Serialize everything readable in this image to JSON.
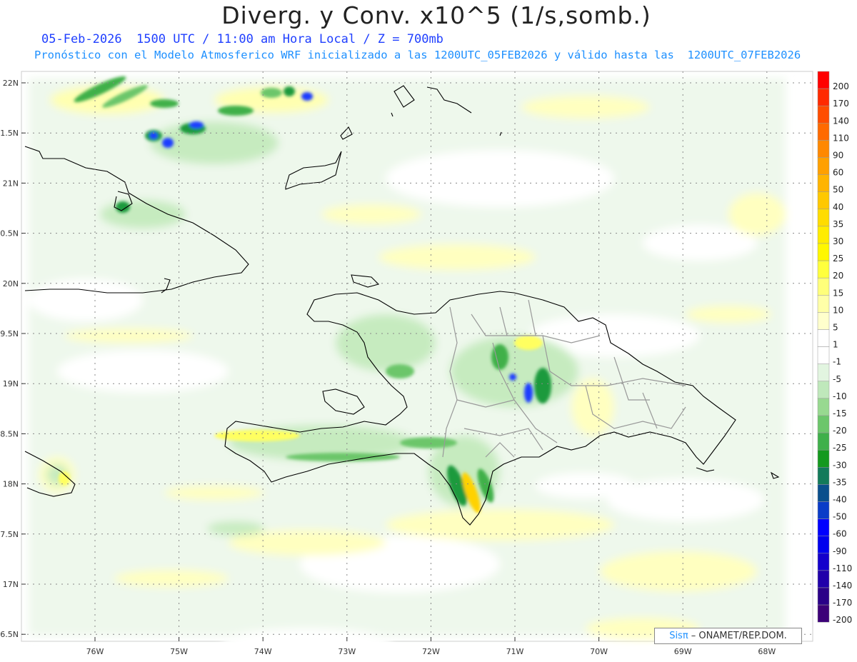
{
  "header": {
    "title": "Diverg. y Conv. x10^5 (1/s,somb.)",
    "line1": "05-Feb-2026  1500 UTC / 11:00 am Hora Local / Z = 700mb",
    "line2": "Pronóstico con el Modelo Atmosferico WRF inicializado a las 1200UTC_05FEB2026 y válido hasta las  1200UTC_07FEB2026"
  },
  "map": {
    "lat_labels": [
      "22N",
      "21.5N",
      "21N",
      "20.5N",
      "20N",
      "19.5N",
      "19N",
      "18.5N",
      "18N",
      "17.5N",
      "17N",
      "16.5N"
    ],
    "lon_labels": [
      "76W",
      "75W",
      "74W",
      "73W",
      "72W",
      "71W",
      "70W",
      "69W",
      "68W"
    ],
    "lat_range": [
      16.5,
      22
    ],
    "lon_range": [
      -76,
      -68
    ],
    "grid": "dotted",
    "colors": {
      "positive_light": "#ffffc0",
      "negative_light": "#e2f5e0",
      "negative_medium": "#a8dca0",
      "negative_strong": "#1f9a3c",
      "negative_extreme": "#1e3cff",
      "coast": "#000000",
      "provinces": "#999999"
    }
  },
  "colorbar": {
    "labels": [
      "200",
      "170",
      "140",
      "110",
      "90",
      "60",
      "50",
      "40",
      "35",
      "30",
      "25",
      "20",
      "15",
      "10",
      "5",
      "1",
      "-1",
      "-5",
      "-10",
      "-15",
      "-20",
      "-25",
      "-30",
      "-35",
      "-40",
      "-50",
      "-60",
      "-90",
      "-110",
      "-140",
      "-170",
      "-200"
    ],
    "colors": [
      "#ff0000",
      "#ff2a00",
      "#ff4d00",
      "#ff6a00",
      "#ff8800",
      "#ffa000",
      "#ffb400",
      "#ffc800",
      "#ffdc00",
      "#ffec00",
      "#fff700",
      "#ffff3c",
      "#ffff7a",
      "#ffffa8",
      "#ffffcc",
      "#ffffff",
      "#ffffff",
      "#e2f5e0",
      "#bfe8bb",
      "#98d990",
      "#6cc66b",
      "#3fb04a",
      "#14991e",
      "#137a5a",
      "#0a4f8c",
      "#0a3cc8",
      "#0000ff",
      "#0000ee",
      "#1400cc",
      "#2000aa",
      "#2a0088",
      "#3c0078"
    ]
  },
  "credit": {
    "brand": "Sisπ",
    "text": " – ONAMET/REP.DOM."
  }
}
